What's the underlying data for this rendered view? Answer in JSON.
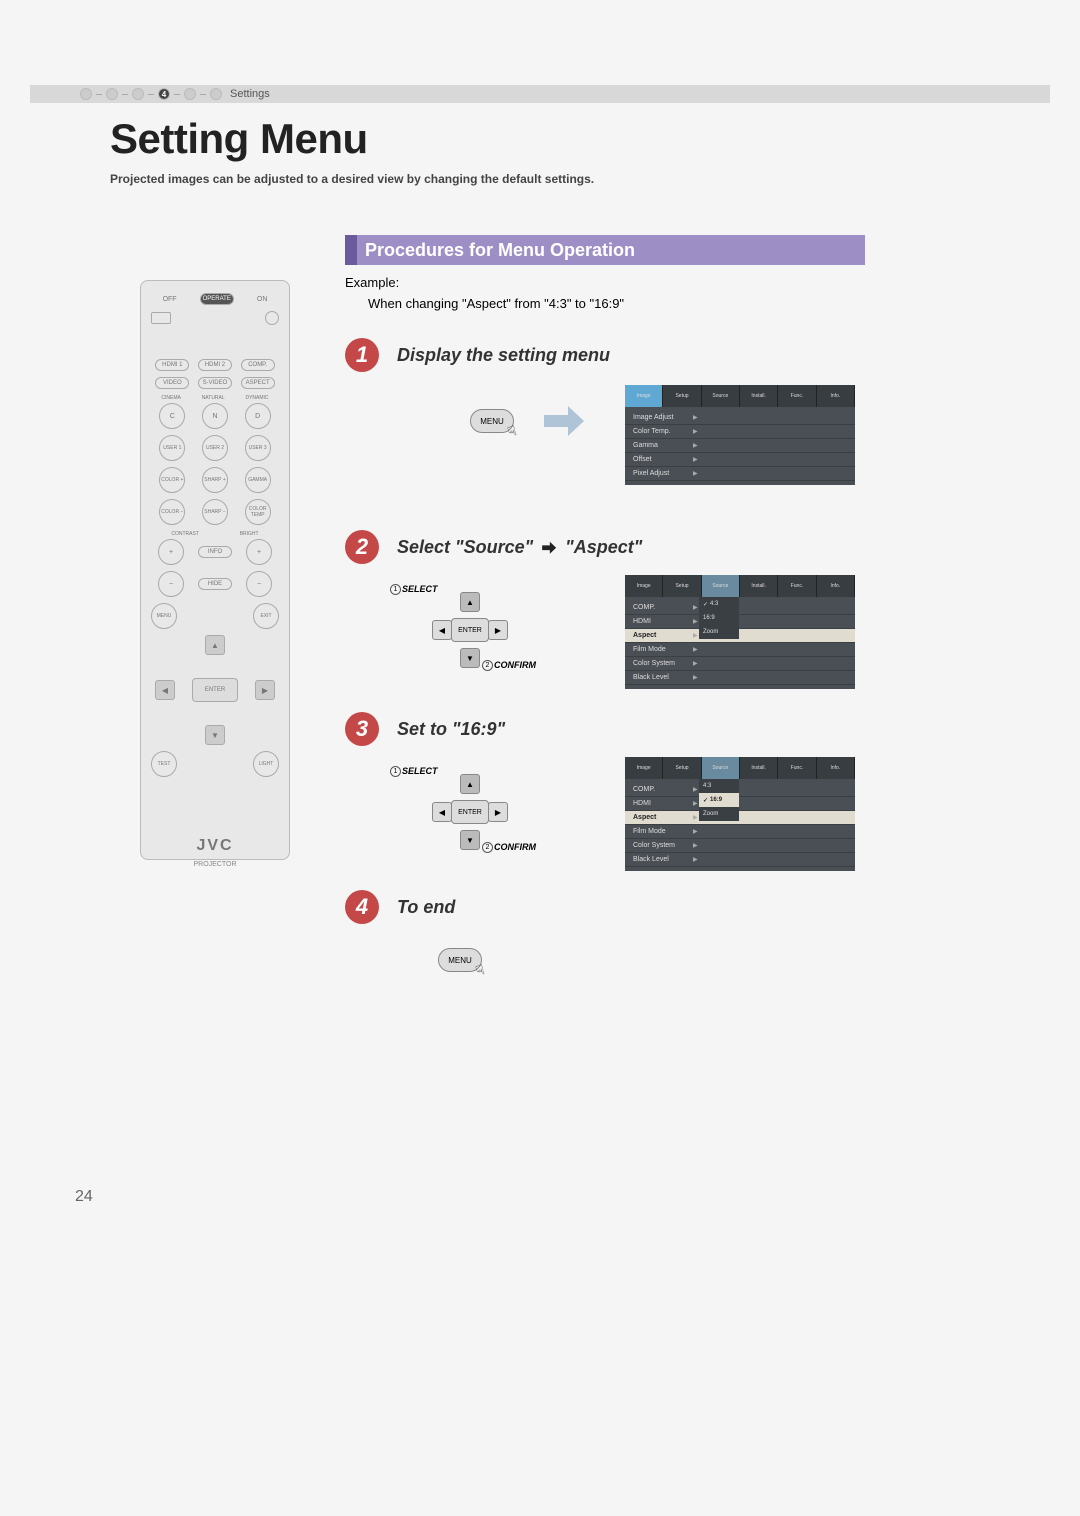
{
  "breadcrumb": {
    "active_index": "4",
    "label": "Settings"
  },
  "title": "Setting Menu",
  "subtitle": "Projected images can be adjusted to a desired view by changing the default settings.",
  "procedures_header": "Procedures for Menu Operation",
  "example_label": "Example:",
  "example_text": "When changing \"Aspect\" from \"4:3\" to \"16:9\"",
  "steps": [
    {
      "num": "1",
      "title": "Display the setting menu"
    },
    {
      "num": "2",
      "title_a": "Select \"Source\"",
      "title_b": "\"Aspect\""
    },
    {
      "num": "3",
      "title": "Set to \"16:9\""
    },
    {
      "num": "4",
      "title": "To end"
    }
  ],
  "labels": {
    "menu_btn": "MENU",
    "enter_btn": "ENTER",
    "select": "SELECT",
    "confirm": "CONFIRM",
    "circle1": "1",
    "circle2": "2"
  },
  "osd": {
    "tabs": [
      "Image",
      "Setup",
      "Source",
      "Install.",
      "Func.",
      "Info."
    ],
    "image_items": [
      "Image Adjust",
      "Color Temp.",
      "Gamma",
      "Offset",
      "Pixel Adjust"
    ],
    "source_items": [
      "COMP.",
      "HDMI",
      "Aspect",
      "Film Mode",
      "Color System",
      "Black Level"
    ],
    "aspect_options": [
      "4:3",
      "16:9",
      "Zoom"
    ]
  },
  "remote": {
    "off": "OFF",
    "operate": "OPERATE",
    "on": "ON",
    "row1": [
      "HDMI 1",
      "HDMI 2",
      "COMP."
    ],
    "row2": [
      "VIDEO",
      "S-VIDEO",
      "ASPECT"
    ],
    "row3_lbl": [
      "CINEMA",
      "NATURAL",
      "DYNAMIC"
    ],
    "row3": [
      "C",
      "N",
      "D"
    ],
    "row4": [
      "USER 1",
      "USER 2",
      "USER 3"
    ],
    "row5": [
      "COLOR +",
      "SHARP +",
      "GAMMA"
    ],
    "row6": [
      "COLOR −",
      "SHARP −",
      "COLOR TEMP"
    ],
    "contrast": "CONTRAST",
    "bright": "BRIGHT",
    "info": "INFO",
    "hide": "HIDE",
    "menu": "MENU",
    "exit": "EXIT",
    "enter": "ENTER",
    "test": "TEST",
    "light": "LIGHT",
    "brand": "JVC",
    "brand_sub": "PROJECTOR"
  },
  "page_number": "24"
}
